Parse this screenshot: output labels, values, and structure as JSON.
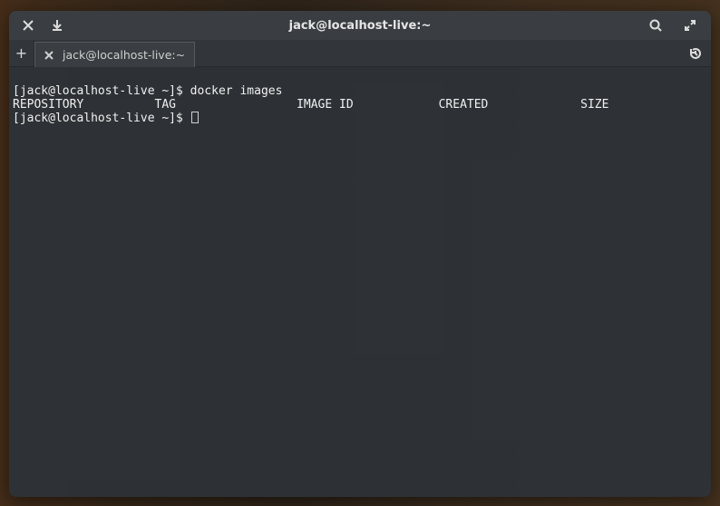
{
  "window": {
    "title": "jack@localhost-live:~"
  },
  "titlebar_icons": {
    "close": "close-icon",
    "download": "download-icon",
    "search": "search-icon",
    "fullscreen": "fullscreen-icon"
  },
  "tabbar": {
    "new_tab_label": "+",
    "tabs": [
      {
        "label": "jack@localhost-live:~"
      }
    ],
    "history_icon": "history-icon"
  },
  "terminal": {
    "prompt_1": "[jack@localhost-live ~]$ ",
    "command_1": "docker images",
    "headers_line": "REPOSITORY          TAG                 IMAGE ID            CREATED             SIZE",
    "prompt_2": "[jack@localhost-live ~]$ "
  }
}
